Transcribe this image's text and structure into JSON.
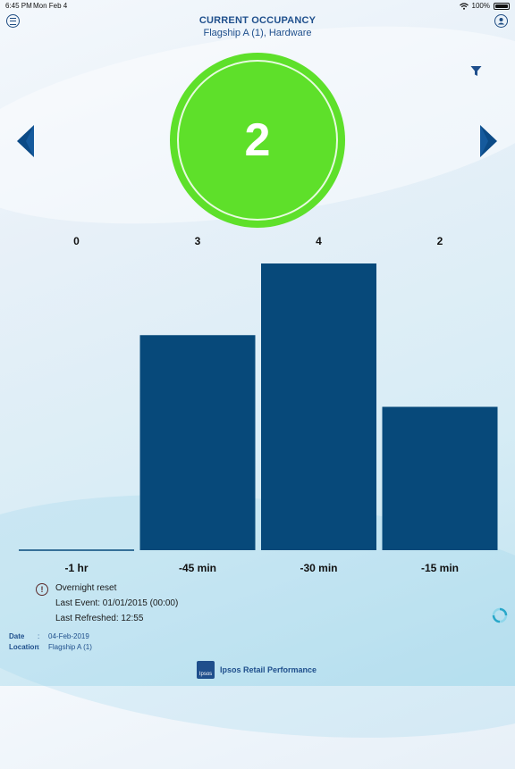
{
  "status_bar": {
    "time": "6:45 PM",
    "date": "Mon Feb 4",
    "battery": "100%"
  },
  "header": {
    "title": "CURRENT OCCUPANCY",
    "subtitle": "Flagship A (1), Hardware"
  },
  "occupancy": {
    "value": "2",
    "color": "#5ee02a"
  },
  "chart_data": {
    "type": "bar",
    "categories": [
      "-1 hr",
      "-45 min",
      "-30 min",
      "-15 min"
    ],
    "values": [
      0,
      3,
      4,
      2
    ],
    "data_labels": [
      "0",
      "3",
      "4",
      "2"
    ],
    "bar_color": "#07497a",
    "title": "",
    "xlabel": "",
    "ylabel": ""
  },
  "info": {
    "reset_label": "Overnight reset",
    "last_event": "Last Event: 01/01/2015 (00:00)",
    "last_refreshed": "Last Refreshed: 12:55"
  },
  "meta": {
    "date_label": "Date",
    "date_value": "04-Feb-2019",
    "location_label": "Location",
    "location_value": "Flagship A (1)",
    "separator": ":"
  },
  "footer": {
    "brand": "Ipsos Retail Performance",
    "logo_text": "Ipsos"
  },
  "icons": {
    "menu": "menu-icon",
    "user": "user-icon",
    "filter": "filter-icon",
    "prev": "arrow-left-icon",
    "next": "arrow-right-icon",
    "alert": "alert-icon",
    "refresh": "refresh-icon"
  },
  "colors": {
    "accent": "#1f4f8c",
    "bar": "#07497a",
    "occupancy": "#5ee02a"
  }
}
